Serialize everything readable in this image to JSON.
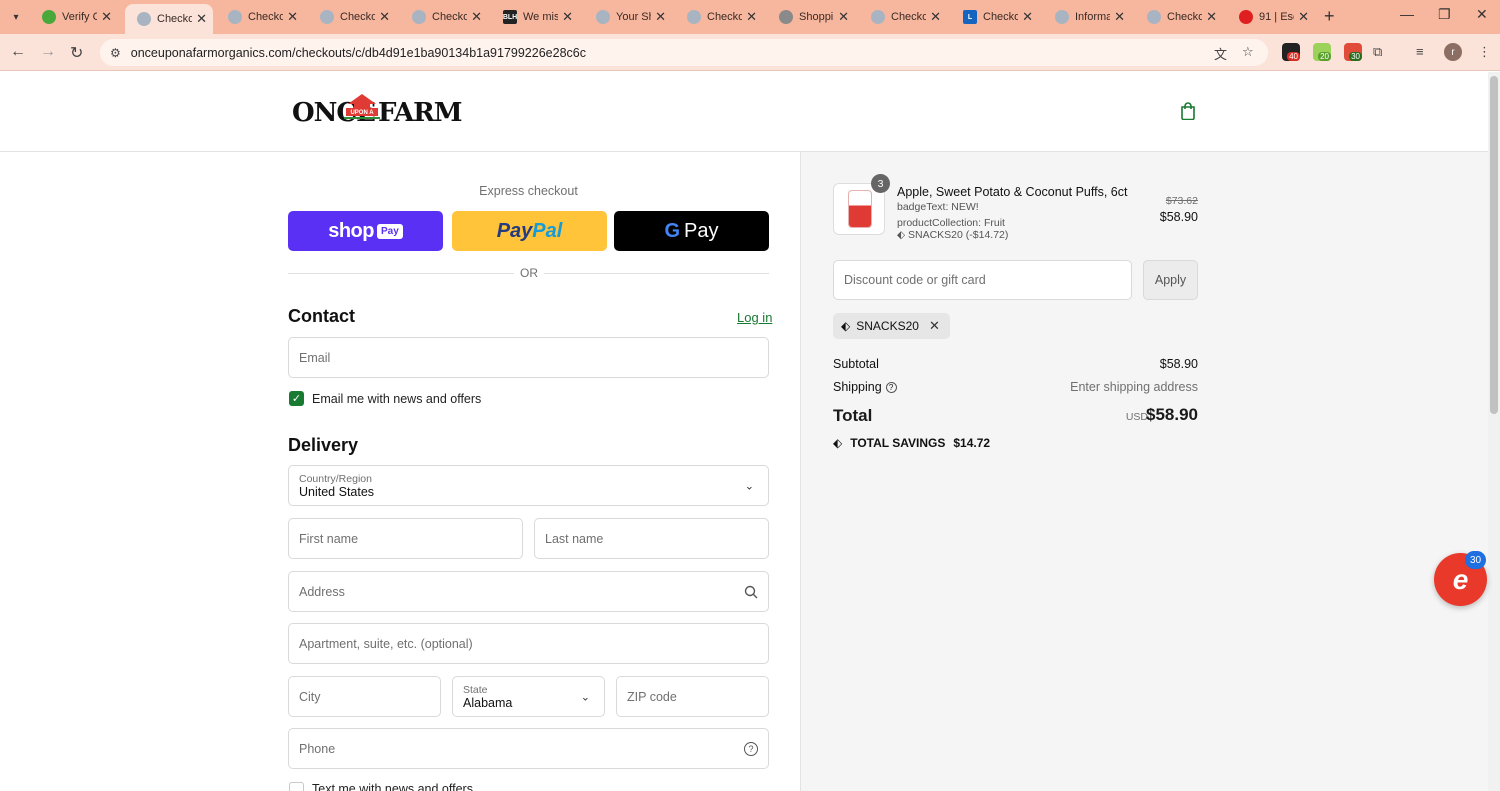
{
  "browser": {
    "tabs": [
      {
        "title": "Verify C",
        "favicon_color": "#49a83a"
      },
      {
        "title": "Checko",
        "favicon_color": "#a9b4c2",
        "active": true
      },
      {
        "title": "Checko",
        "favicon_color": "#a9b4c2"
      },
      {
        "title": "Checko",
        "favicon_color": "#a9b4c2"
      },
      {
        "title": "Checko",
        "favicon_color": "#a9b4c2"
      },
      {
        "title": "We mis",
        "favicon_color": "#222222",
        "favicon_text": "BLH"
      },
      {
        "title": "Your Sh",
        "favicon_color": "#a9b4c2"
      },
      {
        "title": "Checko",
        "favicon_color": "#a9b4c2"
      },
      {
        "title": "Shoppi",
        "favicon_color": "#8a8a8a"
      },
      {
        "title": "Checko",
        "favicon_color": "#a9b4c2"
      },
      {
        "title": "Checko",
        "favicon_color": "#1565c0",
        "favicon_text": "L"
      },
      {
        "title": "Informa",
        "favicon_color": "#a9b4c2"
      },
      {
        "title": "Checko",
        "favicon_color": "#a9b4c2"
      },
      {
        "title": "91 | Esc",
        "favicon_color": "#e02020"
      }
    ],
    "url": "onceuponafarmorganics.com/checkouts/c/db4d91e1ba90134b1a91799226e28c6c",
    "extensions": [
      {
        "badge": "40",
        "color": "#d93025"
      },
      {
        "badge": "20",
        "color": "#5aa02c"
      },
      {
        "badge": "30",
        "color": "#d93025"
      }
    ],
    "profile_initial": "r"
  },
  "header": {
    "logo_text": "ONCE UPON A FARM",
    "logo_once": "ONCE",
    "logo_farm": "FARM",
    "logo_upon": "UPON A"
  },
  "express": {
    "title": "Express checkout",
    "shop_label": "shop",
    "shop_pay": "Pay",
    "paypal_a": "Pay",
    "paypal_b": "Pal",
    "gpay_g": "G",
    "gpay_label": "Pay",
    "or": "OR"
  },
  "contact": {
    "title": "Contact",
    "login": "Log in",
    "email_placeholder": "Email",
    "news_label": "Email me with news and offers",
    "news_checked": true
  },
  "delivery": {
    "title": "Delivery",
    "country_label": "Country/Region",
    "country_value": "United States",
    "first_name": "First name",
    "last_name": "Last name",
    "address": "Address",
    "apartment": "Apartment, suite, etc. (optional)",
    "city": "City",
    "state_label": "State",
    "state_value": "Alabama",
    "zip": "ZIP code",
    "phone": "Phone",
    "sms_label": "Text me with news and offers",
    "sms_checked": false
  },
  "summary": {
    "item": {
      "quantity": "3",
      "name": "Apple, Sweet Potato & Coconut Puffs, 6ct",
      "badge_text": "badgeText: NEW!",
      "collection": "productCollection: Fruit",
      "discount": "SNACKS20 (-$14.72)",
      "old_price": "$73.62",
      "price": "$58.90"
    },
    "discount_placeholder": "Discount code or gift card",
    "apply": "Apply",
    "applied_code": "SNACKS20",
    "subtotal_label": "Subtotal",
    "subtotal_value": "$58.90",
    "shipping_label": "Shipping",
    "shipping_value": "Enter shipping address",
    "total_label": "Total",
    "currency": "USD",
    "total_value": "$58.90",
    "savings_label": "TOTAL SAVINGS",
    "savings_value": "$14.72"
  },
  "chat": {
    "count": "30",
    "glyph": "e"
  },
  "colors": {
    "accent": "#197a31",
    "shop_pay": "#5a31f4",
    "paypal": "#ffc439",
    "tabbar": "#f6b79e"
  }
}
